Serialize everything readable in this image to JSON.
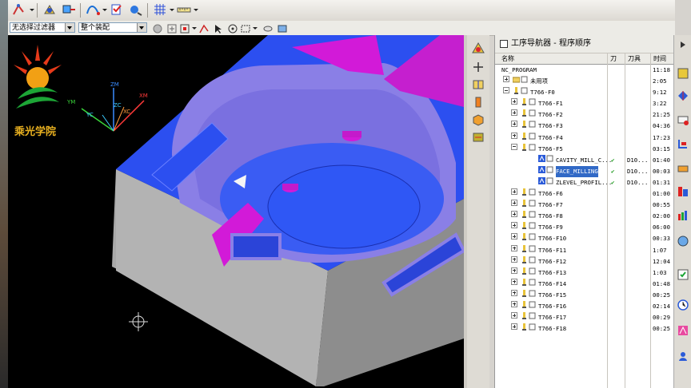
{
  "toolbar_filters": {
    "selection_filter": "无选择过滤器",
    "assembly_scope": "整个装配"
  },
  "logo": {
    "text": "乘光学院"
  },
  "axes": {
    "zm": "ZM",
    "ym": "YM",
    "xm": "XM",
    "zc": "ZC",
    "yc": "YC",
    "xc": "XC"
  },
  "navigator": {
    "title": "工序导航器 - 程序顺序",
    "columns": {
      "name": "名称",
      "tool_path": "刀",
      "tool": "刀具",
      "time": "时间"
    },
    "rows": [
      {
        "name": "NC_PROGRAM",
        "tool": "",
        "time": "11:18",
        "level": 0,
        "expander": "none",
        "icon": "none",
        "check": ""
      },
      {
        "name": "未用项",
        "tool": "",
        "time": "2:05",
        "level": 1,
        "expander": "plus",
        "icon": "folder",
        "check": ""
      },
      {
        "name": "T766-F0",
        "tool": "",
        "time": "9:12",
        "level": 1,
        "expander": "minus",
        "icon": "program",
        "check": ""
      },
      {
        "name": "T766-F1",
        "tool": "",
        "time": "3:22",
        "level": 2,
        "expander": "plus",
        "icon": "program",
        "check": ""
      },
      {
        "name": "T766-F2",
        "tool": "",
        "time": "21:25",
        "level": 2,
        "expander": "plus",
        "icon": "program",
        "check": ""
      },
      {
        "name": "T766-F3",
        "tool": "",
        "time": "04:36",
        "level": 2,
        "expander": "plus",
        "icon": "program",
        "check": ""
      },
      {
        "name": "T766-F4",
        "tool": "",
        "time": "17:23",
        "level": 2,
        "expander": "plus",
        "icon": "program",
        "check": ""
      },
      {
        "name": "T766-F5",
        "tool": "",
        "time": "03:15",
        "level": 2,
        "expander": "minus",
        "icon": "program",
        "check": ""
      },
      {
        "name": "CAVITY_MILL_C...",
        "tool": "D10...",
        "time": "01:40",
        "level": 3,
        "expander": "none",
        "icon": "op",
        "check": "✔"
      },
      {
        "name": "FACE_MILLING",
        "tool": "D10...",
        "time": "00:03",
        "level": 3,
        "expander": "none",
        "icon": "op",
        "check": "✔",
        "selected": true
      },
      {
        "name": "ZLEVEL_PROFIL...",
        "tool": "D10...",
        "time": "01:31",
        "level": 3,
        "expander": "none",
        "icon": "op",
        "check": "✔"
      },
      {
        "name": "T766-F6",
        "tool": "",
        "time": "01:00",
        "level": 2,
        "expander": "plus",
        "icon": "program",
        "check": ""
      },
      {
        "name": "T766-F7",
        "tool": "",
        "time": "00:55",
        "level": 2,
        "expander": "plus",
        "icon": "program",
        "check": ""
      },
      {
        "name": "T766-F8",
        "tool": "",
        "time": "02:00",
        "level": 2,
        "expander": "plus",
        "icon": "program",
        "check": ""
      },
      {
        "name": "T766-F9",
        "tool": "",
        "time": "06:00",
        "level": 2,
        "expander": "plus",
        "icon": "program",
        "check": ""
      },
      {
        "name": "T766-F10",
        "tool": "",
        "time": "00:33",
        "level": 2,
        "expander": "plus",
        "icon": "program",
        "check": ""
      },
      {
        "name": "T766-F11",
        "tool": "",
        "time": "1:07",
        "level": 2,
        "expander": "plus",
        "icon": "program",
        "check": ""
      },
      {
        "name": "T766-F12",
        "tool": "",
        "time": "12:04",
        "level": 2,
        "expander": "plus",
        "icon": "program",
        "check": ""
      },
      {
        "name": "T766-F13",
        "tool": "",
        "time": "1:03",
        "level": 2,
        "expander": "plus",
        "icon": "program",
        "check": ""
      },
      {
        "name": "T766-F14",
        "tool": "",
        "time": "01:48",
        "level": 2,
        "expander": "plus",
        "icon": "program",
        "check": ""
      },
      {
        "name": "T766-F15",
        "tool": "",
        "time": "00:25",
        "level": 2,
        "expander": "plus",
        "icon": "program",
        "check": ""
      },
      {
        "name": "T766-F16",
        "tool": "",
        "time": "02:14",
        "level": 2,
        "expander": "plus",
        "icon": "program",
        "check": ""
      },
      {
        "name": "T766-F17",
        "tool": "",
        "time": "00:29",
        "level": 2,
        "expander": "plus",
        "icon": "program",
        "check": ""
      },
      {
        "name": "T766-F18",
        "tool": "",
        "time": "00:25",
        "level": 2,
        "expander": "plus",
        "icon": "program",
        "check": ""
      }
    ]
  },
  "colors": {
    "model_blue": "#2c4ff0",
    "model_purple": "#8a7fe6",
    "model_magenta": "#d21ad8",
    "model_gray": "#b4b4b4",
    "selection": "#3169c6",
    "check_green": "#1f9a1f"
  }
}
